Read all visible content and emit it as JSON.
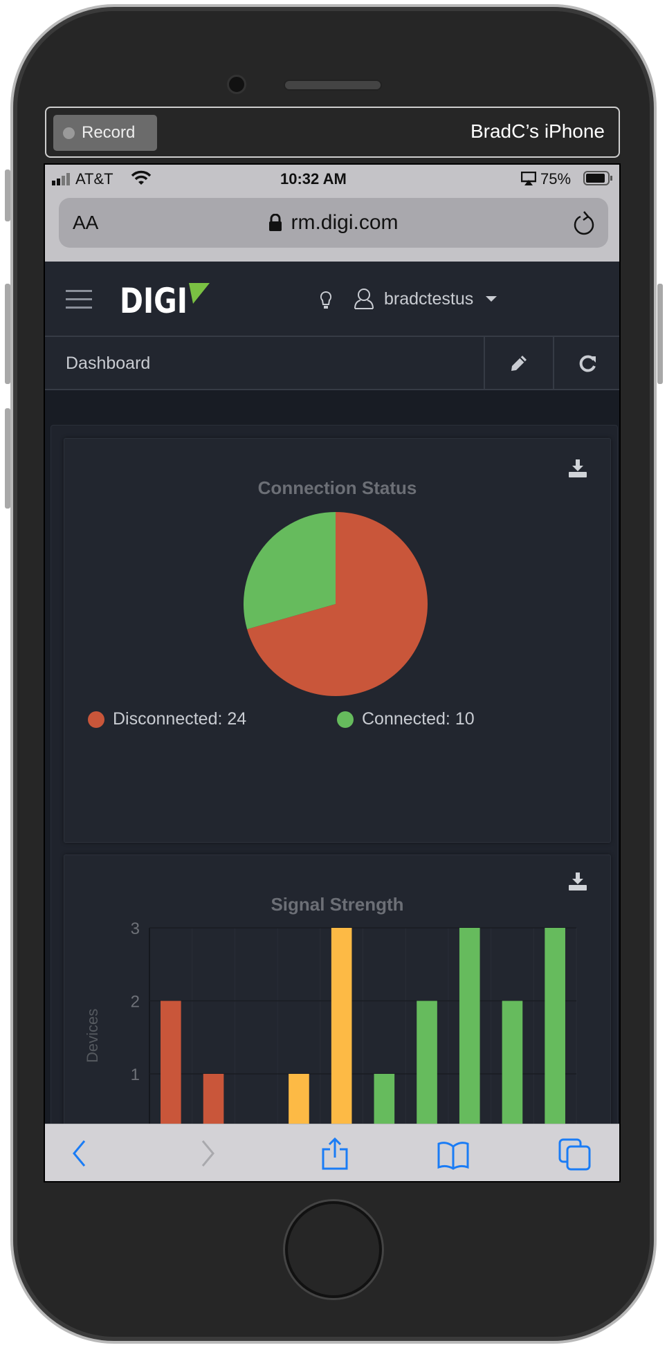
{
  "recorder": {
    "record_label": "Record",
    "device_name": "BradC’s iPhone"
  },
  "status_bar": {
    "carrier": "AT&T",
    "time": "10:32 AM",
    "battery": "75%"
  },
  "browser": {
    "text_size_label": "AA",
    "url": "rm.digi.com"
  },
  "nav": {
    "logo": "DIGI",
    "username": "bradctestus"
  },
  "dashboard": {
    "title": "Dashboard"
  },
  "colors": {
    "red": "#c9563a",
    "green": "#66bb5d",
    "yellow": "#fdba45",
    "background": "#22262f"
  },
  "chart_data": [
    {
      "type": "pie",
      "title": "Connection Status",
      "slices": [
        {
          "label": "Disconnected",
          "value": 24,
          "color": "#c9563a",
          "legend": "Disconnected: 24"
        },
        {
          "label": "Connected",
          "value": 10,
          "color": "#66bb5d",
          "legend": "Connected: 10"
        }
      ],
      "legend_placement": "bottom"
    },
    {
      "type": "bar",
      "title": "Signal Strength",
      "ylabel": "Devices",
      "ylim": [
        0,
        3
      ],
      "yticks": [
        "1",
        "2",
        "3"
      ],
      "grid": true,
      "values": [
        2,
        1,
        0,
        1,
        3,
        1,
        2,
        3,
        2,
        3
      ],
      "colors": [
        "#c9563a",
        "#c9563a",
        "#c9563a",
        "#fdba45",
        "#fdba45",
        "#66bb5d",
        "#66bb5d",
        "#66bb5d",
        "#66bb5d",
        "#66bb5d"
      ]
    }
  ]
}
